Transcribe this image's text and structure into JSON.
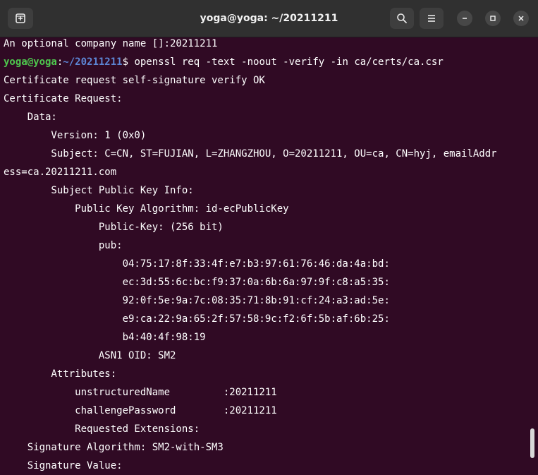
{
  "window": {
    "title": "yoga@yoga: ~/20211211"
  },
  "icons": {
    "new_tab": "new-tab-icon",
    "search": "search-icon",
    "menu": "hamburger-menu-icon",
    "minimize": "minimize-icon",
    "maximize": "maximize-icon",
    "close": "close-icon"
  },
  "colors": {
    "terminal_bg": "#300a24",
    "titlebar_bg": "#303030",
    "prompt_user": "#4ec94e",
    "prompt_path": "#5d86d6",
    "text": "#ffffff"
  },
  "terminal": {
    "line_company": "An optional company name []:20211211",
    "prompt": {
      "user": "yoga@yoga",
      "sep": ":",
      "path": "~/20211211",
      "command": "$ openssl req -text -noout -verify -in ca/certs/ca.csr"
    },
    "lines": [
      "Certificate request self-signature verify OK",
      "Certificate Request:",
      "    Data:",
      "        Version: 1 (0x0)",
      "        Subject: C=CN, ST=FUJIAN, L=ZHANGZHOU, O=20211211, OU=ca, CN=hyj, emailAddr",
      "ess=ca.20211211.com",
      "        Subject Public Key Info:",
      "            Public Key Algorithm: id-ecPublicKey",
      "                Public-Key: (256 bit)",
      "                pub:",
      "                    04:75:17:8f:33:4f:e7:b3:97:61:76:46:da:4a:bd:",
      "                    ec:3d:55:6c:bc:f9:37:0a:6b:6a:97:9f:c8:a5:35:",
      "                    92:0f:5e:9a:7c:08:35:71:8b:91:cf:24:a3:ad:5e:",
      "                    e9:ca:22:9a:65:2f:57:58:9c:f2:6f:5b:af:6b:25:",
      "                    b4:40:4f:98:19",
      "                ASN1 OID: SM2",
      "        Attributes:",
      "            unstructuredName         :20211211",
      "            challengePassword        :20211211",
      "            Requested Extensions:",
      "    Signature Algorithm: SM2-with-SM3",
      "    Signature Value:"
    ]
  }
}
